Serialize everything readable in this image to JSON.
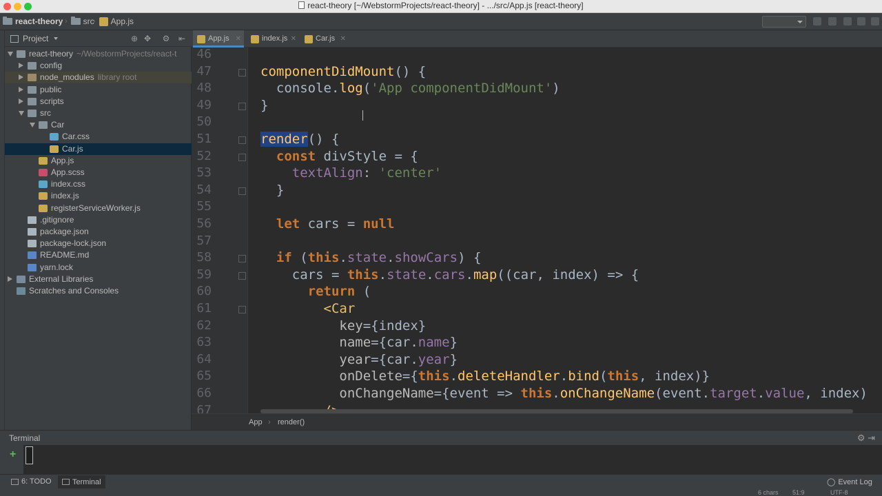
{
  "window": {
    "title": "react-theory [~/WebstormProjects/react-theory] - .../src/App.js [react-theory]"
  },
  "breadcrumb": {
    "project": "react-theory",
    "folder": "src",
    "file": "App.js"
  },
  "project_panel": {
    "title": "Project",
    "items": [
      {
        "label": "react-theory",
        "extra": "~/WebstormProjects/react-t",
        "type": "folder",
        "depth": 0,
        "expanded": true
      },
      {
        "label": "config",
        "type": "folder",
        "depth": 1,
        "expanded": false
      },
      {
        "label": "node_modules",
        "extra": "library root",
        "type": "folder-lib",
        "depth": 1,
        "expanded": false
      },
      {
        "label": "public",
        "type": "folder",
        "depth": 1,
        "expanded": false
      },
      {
        "label": "scripts",
        "type": "folder",
        "depth": 1,
        "expanded": false
      },
      {
        "label": "src",
        "type": "folder",
        "depth": 1,
        "expanded": true
      },
      {
        "label": "Car",
        "type": "folder",
        "depth": 2,
        "expanded": true
      },
      {
        "label": "Car.css",
        "type": "css",
        "depth": 3
      },
      {
        "label": "Car.js",
        "type": "js",
        "depth": 3,
        "selected": true
      },
      {
        "label": "App.js",
        "type": "js",
        "depth": 2
      },
      {
        "label": "App.scss",
        "type": "scss",
        "depth": 2
      },
      {
        "label": "index.css",
        "type": "css",
        "depth": 2
      },
      {
        "label": "index.js",
        "type": "js",
        "depth": 2
      },
      {
        "label": "registerServiceWorker.js",
        "type": "js",
        "depth": 2
      },
      {
        "label": ".gitignore",
        "type": "file",
        "depth": 1
      },
      {
        "label": "package.json",
        "type": "json",
        "depth": 1
      },
      {
        "label": "package-lock.json",
        "type": "json",
        "depth": 1
      },
      {
        "label": "README.md",
        "type": "md",
        "depth": 1
      },
      {
        "label": "yarn.lock",
        "type": "yarn",
        "depth": 1
      },
      {
        "label": "External Libraries",
        "type": "extlib",
        "depth": 0,
        "expanded": false
      },
      {
        "label": "Scratches and Consoles",
        "type": "scratch",
        "depth": 0
      }
    ]
  },
  "tabs": [
    {
      "label": "App.js",
      "active": true
    },
    {
      "label": "index.js",
      "active": false
    },
    {
      "label": "Car.js",
      "active": false
    }
  ],
  "editor": {
    "line_numbers": [
      "46",
      "47",
      "48",
      "49",
      "50",
      "51",
      "52",
      "53",
      "54",
      "55",
      "56",
      "57",
      "58",
      "59",
      "60",
      "61",
      "62",
      "63",
      "64",
      "65",
      "66",
      "67"
    ],
    "lines": [
      [],
      [
        {
          "t": "componentDidMount",
          "c": "fn"
        },
        {
          "t": "() {",
          "c": ""
        }
      ],
      [
        {
          "t": "  console.",
          "c": ""
        },
        {
          "t": "log",
          "c": "fn"
        },
        {
          "t": "(",
          "c": ""
        },
        {
          "t": "'App componentDidMount'",
          "c": "str"
        },
        {
          "t": ")",
          "c": ""
        }
      ],
      [
        {
          "t": "}",
          "c": ""
        }
      ],
      [],
      [
        {
          "t": "render",
          "c": "fn hl"
        },
        {
          "t": "() {",
          "c": ""
        }
      ],
      [
        {
          "t": "  ",
          "c": ""
        },
        {
          "t": "const",
          "c": "kw"
        },
        {
          "t": " divStyle = {",
          "c": ""
        }
      ],
      [
        {
          "t": "    ",
          "c": ""
        },
        {
          "t": "textAlign",
          "c": "prop"
        },
        {
          "t": ": ",
          "c": ""
        },
        {
          "t": "'center'",
          "c": "str"
        }
      ],
      [
        {
          "t": "  }",
          "c": ""
        }
      ],
      [],
      [
        {
          "t": "  ",
          "c": ""
        },
        {
          "t": "let",
          "c": "kw"
        },
        {
          "t": " cars = ",
          "c": ""
        },
        {
          "t": "null",
          "c": "kw"
        }
      ],
      [],
      [
        {
          "t": "  ",
          "c": ""
        },
        {
          "t": "if",
          "c": "kw"
        },
        {
          "t": " (",
          "c": ""
        },
        {
          "t": "this",
          "c": "kw"
        },
        {
          "t": ".",
          "c": ""
        },
        {
          "t": "state",
          "c": "prop"
        },
        {
          "t": ".",
          "c": ""
        },
        {
          "t": "showCars",
          "c": "prop"
        },
        {
          "t": ") {",
          "c": ""
        }
      ],
      [
        {
          "t": "    cars = ",
          "c": ""
        },
        {
          "t": "this",
          "c": "kw"
        },
        {
          "t": ".",
          "c": ""
        },
        {
          "t": "state",
          "c": "prop"
        },
        {
          "t": ".",
          "c": ""
        },
        {
          "t": "cars",
          "c": "prop"
        },
        {
          "t": ".",
          "c": ""
        },
        {
          "t": "map",
          "c": "fn"
        },
        {
          "t": "((car, index) => {",
          "c": ""
        }
      ],
      [
        {
          "t": "      ",
          "c": ""
        },
        {
          "t": "return",
          "c": "kw"
        },
        {
          "t": " (",
          "c": ""
        }
      ],
      [
        {
          "t": "        ",
          "c": ""
        },
        {
          "t": "<Car",
          "c": "tag"
        }
      ],
      [
        {
          "t": "          ",
          "c": ""
        },
        {
          "t": "key",
          "c": "attr"
        },
        {
          "t": "={index}",
          "c": ""
        }
      ],
      [
        {
          "t": "          ",
          "c": ""
        },
        {
          "t": "name",
          "c": "attr"
        },
        {
          "t": "={car.",
          "c": ""
        },
        {
          "t": "name",
          "c": "prop"
        },
        {
          "t": "}",
          "c": ""
        }
      ],
      [
        {
          "t": "          ",
          "c": ""
        },
        {
          "t": "year",
          "c": "attr"
        },
        {
          "t": "={car.",
          "c": ""
        },
        {
          "t": "year",
          "c": "prop"
        },
        {
          "t": "}",
          "c": ""
        }
      ],
      [
        {
          "t": "          ",
          "c": ""
        },
        {
          "t": "onDelete",
          "c": "attr"
        },
        {
          "t": "={",
          "c": ""
        },
        {
          "t": "this",
          "c": "kw"
        },
        {
          "t": ".",
          "c": ""
        },
        {
          "t": "deleteHandler",
          "c": "fn"
        },
        {
          "t": ".",
          "c": ""
        },
        {
          "t": "bind",
          "c": "fn"
        },
        {
          "t": "(",
          "c": ""
        },
        {
          "t": "this",
          "c": "kw"
        },
        {
          "t": ", index)}",
          "c": ""
        }
      ],
      [
        {
          "t": "          ",
          "c": ""
        },
        {
          "t": "onChangeName",
          "c": "attr"
        },
        {
          "t": "={event => ",
          "c": ""
        },
        {
          "t": "this",
          "c": "kw"
        },
        {
          "t": ".",
          "c": ""
        },
        {
          "t": "onChangeName",
          "c": "fn"
        },
        {
          "t": "(event.",
          "c": ""
        },
        {
          "t": "target",
          "c": "prop"
        },
        {
          "t": ".",
          "c": ""
        },
        {
          "t": "value",
          "c": "prop"
        },
        {
          "t": ", index)",
          "c": ""
        }
      ],
      [
        {
          "t": "        ",
          "c": ""
        },
        {
          "t": "/>",
          "c": "tag"
        }
      ]
    ]
  },
  "editor_breadcrumb": {
    "class": "App",
    "method": "render()"
  },
  "terminal": {
    "title": "Terminal"
  },
  "bottom_tabs": {
    "todo": "6: TODO",
    "terminal": "Terminal",
    "event_log": "Event Log"
  },
  "status": {
    "chars": "6 chars",
    "position": "51:9",
    "encoding": "UTF-8"
  }
}
